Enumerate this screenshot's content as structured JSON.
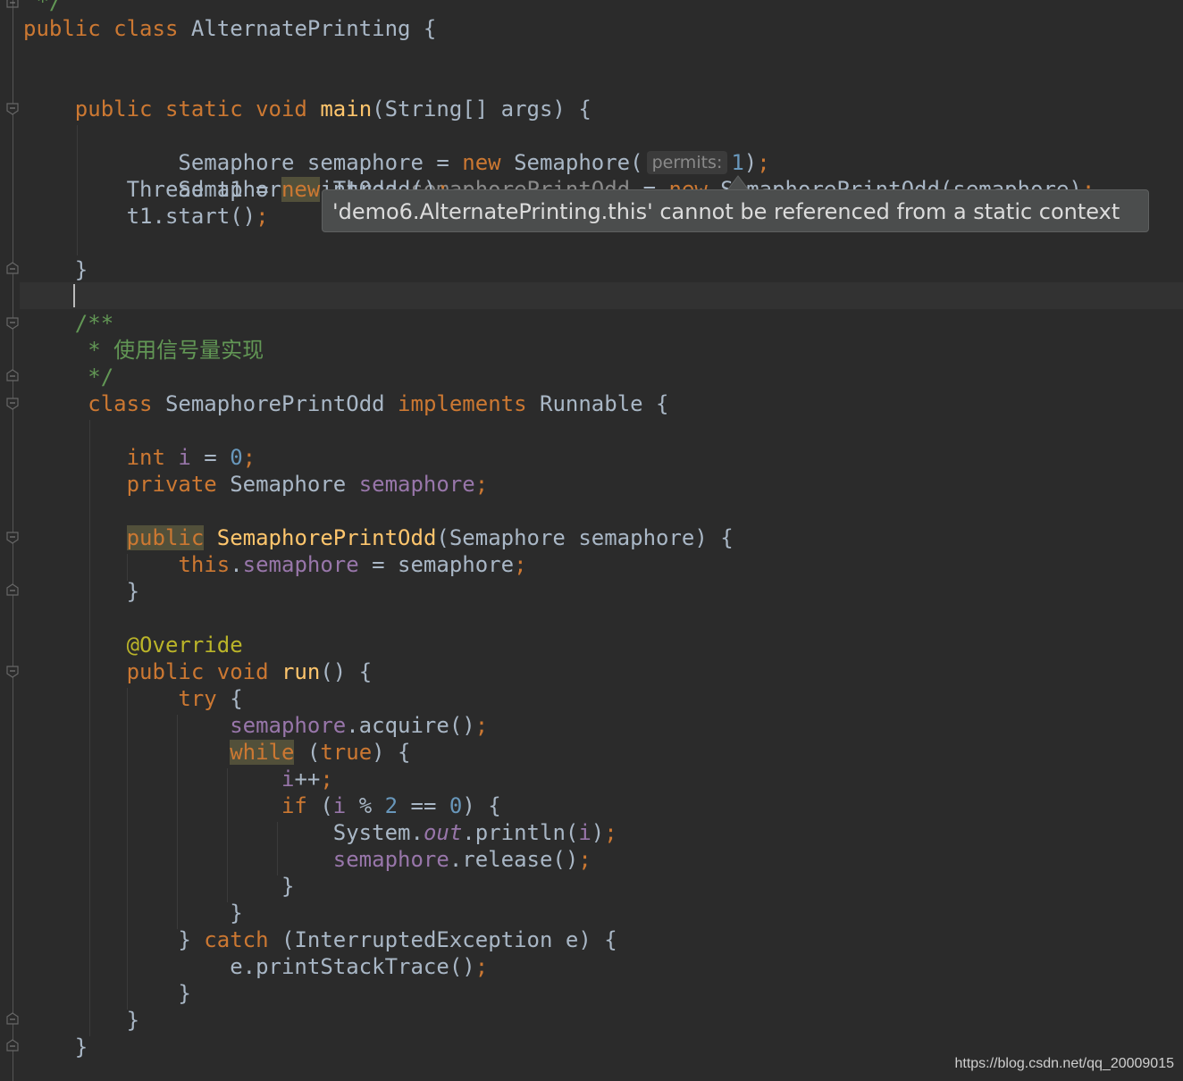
{
  "editor": {
    "tooltip": "'demo6.AlternatePrinting.this' cannot be referenced from a static context",
    "watermark": "https://blog.csdn.net/qq_20009015",
    "param_hint": "permits:"
  },
  "colors": {
    "background": "#2b2b2b",
    "keyword": "#cc7832",
    "method": "#ffc66d",
    "number": "#6897bb",
    "field": "#9876aa",
    "doc_comment": "#629755",
    "annotation": "#bbb529",
    "text": "#a9b7c6",
    "error_underline": "#bc3f3c"
  },
  "code": {
    "l0": [
      {
        "t": " */",
        "c": "doc"
      }
    ],
    "l1": [
      {
        "t": "public class ",
        "c": "kw"
      },
      {
        "t": "AlternatePrinting {",
        "c": ""
      }
    ],
    "l2": [
      {
        "t": "    public static void ",
        "c": "kw"
      },
      {
        "t": "main",
        "c": "fn"
      },
      {
        "t": "(String[] args) {",
        "c": ""
      }
    ],
    "l3a": [
      {
        "t": "        Semaphore semaphore = ",
        "c": ""
      },
      {
        "t": "new ",
        "c": "kw"
      },
      {
        "t": "Semaphore(",
        "c": ""
      }
    ],
    "l3b": [
      {
        "t": "1",
        "c": "num"
      },
      {
        "t": ")",
        "c": ""
      },
      {
        "t": ";",
        "c": "kw"
      }
    ],
    "l4a": [
      {
        "t": "        SemaphorePrintOdd ",
        "c": ""
      }
    ],
    "l4b": [
      {
        "t": "semaphorePrintOdd",
        "c": "unused-wave"
      }
    ],
    "l4c": [
      {
        "t": " = ",
        "c": ""
      }
    ],
    "l4d": [
      {
        "t": "new",
        "c": "kw err"
      },
      {
        "t": " SemaphorePrintOdd(semaphore)",
        "c": "err"
      },
      {
        "t": ";",
        "c": "kw"
      }
    ],
    "l5": [
      {
        "t": "        Thread t1 = ",
        "c": ""
      },
      {
        "t": "new",
        "c": "kw hl"
      },
      {
        "t": " Thread()",
        "c": ""
      },
      {
        "t": ";",
        "c": "kw"
      }
    ],
    "l6": [
      {
        "t": "        t1.start()",
        "c": ""
      },
      {
        "t": ";",
        "c": "kw"
      }
    ],
    "l8": [
      {
        "t": "    }",
        "c": ""
      }
    ],
    "l10": [
      {
        "t": "    /**",
        "c": "doc"
      }
    ],
    "l11": [
      {
        "t": "     * 使用信号量实现",
        "c": "doc"
      }
    ],
    "l12": [
      {
        "t": "     */",
        "c": "doc"
      }
    ],
    "l13": [
      {
        "t": "     class ",
        "c": "kw"
      },
      {
        "t": "SemaphorePrintOdd ",
        "c": ""
      },
      {
        "t": "implements ",
        "c": "kw"
      },
      {
        "t": "Runnable {",
        "c": ""
      }
    ],
    "l15": [
      {
        "t": "        int ",
        "c": "kw"
      },
      {
        "t": "i",
        "c": "fld"
      },
      {
        "t": " = ",
        "c": ""
      },
      {
        "t": "0",
        "c": "num"
      },
      {
        "t": ";",
        "c": "kw"
      }
    ],
    "l16": [
      {
        "t": "        private ",
        "c": "kw"
      },
      {
        "t": "Semaphore ",
        "c": ""
      },
      {
        "t": "semaphore",
        "c": "fld"
      },
      {
        "t": ";",
        "c": "kw"
      }
    ],
    "l18": [
      {
        "t": "        ",
        "c": ""
      },
      {
        "t": "public",
        "c": "kw hl"
      },
      {
        "t": " ",
        "c": ""
      },
      {
        "t": "SemaphorePrintOdd",
        "c": "fn"
      },
      {
        "t": "(Semaphore semaphore) {",
        "c": ""
      }
    ],
    "l19": [
      {
        "t": "            this",
        "c": "kw"
      },
      {
        "t": ".",
        "c": ""
      },
      {
        "t": "semaphore",
        "c": "fld"
      },
      {
        "t": " = semaphore",
        "c": ""
      },
      {
        "t": ";",
        "c": "kw"
      }
    ],
    "l20": [
      {
        "t": "        }",
        "c": ""
      }
    ],
    "l22": [
      {
        "t": "        @Override",
        "c": "ann"
      }
    ],
    "l23": [
      {
        "t": "        public void ",
        "c": "kw"
      },
      {
        "t": "run",
        "c": "fn"
      },
      {
        "t": "() {",
        "c": ""
      }
    ],
    "l24": [
      {
        "t": "            try ",
        "c": "kw"
      },
      {
        "t": "{",
        "c": ""
      }
    ],
    "l25": [
      {
        "t": "                ",
        "c": ""
      },
      {
        "t": "semaphore",
        "c": "fld"
      },
      {
        "t": ".acquire()",
        "c": ""
      },
      {
        "t": ";",
        "c": "kw"
      }
    ],
    "l26": [
      {
        "t": "                ",
        "c": ""
      },
      {
        "t": "while",
        "c": "kw hl"
      },
      {
        "t": " (",
        "c": ""
      },
      {
        "t": "true",
        "c": "kw"
      },
      {
        "t": ") {",
        "c": ""
      }
    ],
    "l27": [
      {
        "t": "                    ",
        "c": ""
      },
      {
        "t": "i",
        "c": "fld"
      },
      {
        "t": "++",
        "c": ""
      },
      {
        "t": ";",
        "c": "kw"
      }
    ],
    "l28": [
      {
        "t": "                    if ",
        "c": "kw"
      },
      {
        "t": "(",
        "c": ""
      },
      {
        "t": "i",
        "c": "fld"
      },
      {
        "t": " % ",
        "c": ""
      },
      {
        "t": "2",
        "c": "num"
      },
      {
        "t": " == ",
        "c": ""
      },
      {
        "t": "0",
        "c": "num"
      },
      {
        "t": ") {",
        "c": ""
      }
    ],
    "l29": [
      {
        "t": "                        System.",
        "c": ""
      },
      {
        "t": "out",
        "c": "static"
      },
      {
        "t": ".println(",
        "c": ""
      },
      {
        "t": "i",
        "c": "fld"
      },
      {
        "t": ")",
        "c": ""
      },
      {
        "t": ";",
        "c": "kw"
      }
    ],
    "l30": [
      {
        "t": "                        ",
        "c": ""
      },
      {
        "t": "semaphore",
        "c": "fld"
      },
      {
        "t": ".release()",
        "c": ""
      },
      {
        "t": ";",
        "c": "kw"
      }
    ],
    "l31": [
      {
        "t": "                    }",
        "c": ""
      }
    ],
    "l32": [
      {
        "t": "                }",
        "c": ""
      }
    ],
    "l33": [
      {
        "t": "            } ",
        "c": ""
      },
      {
        "t": "catch ",
        "c": "kw"
      },
      {
        "t": "(InterruptedException e) {",
        "c": ""
      }
    ],
    "l34": [
      {
        "t": "                e.printStackTrace()",
        "c": ""
      },
      {
        "t": ";",
        "c": "kw"
      }
    ],
    "l35": [
      {
        "t": "            }",
        "c": ""
      }
    ],
    "l36": [
      {
        "t": "        }",
        "c": ""
      }
    ],
    "l37": [
      {
        "t": "    }",
        "c": ""
      }
    ]
  }
}
